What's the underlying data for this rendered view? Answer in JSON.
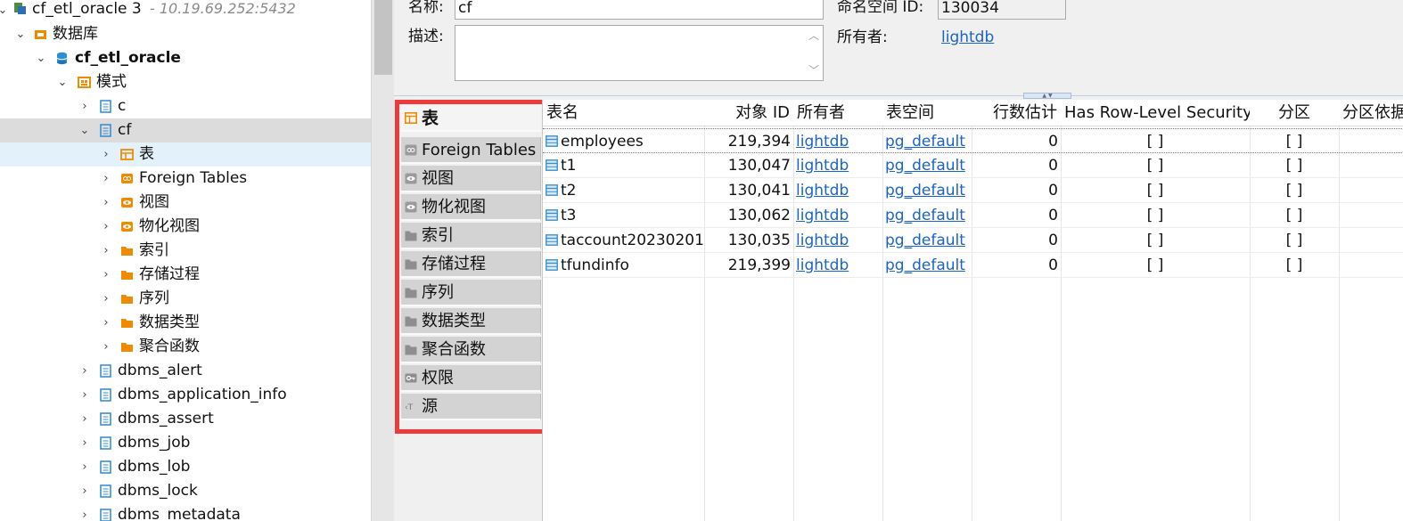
{
  "tree": {
    "connection": {
      "label": "cf_etl_oracle 3",
      "host": "- 10.19.69.252:5432"
    },
    "databases_folder": "数据库",
    "database": "cf_etl_oracle",
    "schemas_folder": "模式",
    "schema_c": "c",
    "schema_cf": "cf",
    "cf_children": [
      "表",
      "Foreign Tables",
      "视图",
      "物化视图",
      "索引",
      "存储过程",
      "序列",
      "数据类型",
      "聚合函数"
    ],
    "other_schemas": [
      "dbms_alert",
      "dbms_application_info",
      "dbms_assert",
      "dbms_job",
      "dbms_lob",
      "dbms_lock",
      "dbms_metadata"
    ]
  },
  "form": {
    "name_label": "名称:",
    "name_value": "cf",
    "namespace_label": "命名空间 ID:",
    "namespace_value": "130034",
    "desc_label": "描述:",
    "owner_label": "所有者:",
    "owner_value": "lightdb"
  },
  "tabs": [
    {
      "label": "表",
      "icon": "table-icon",
      "active": true
    },
    {
      "label": "Foreign Tables",
      "icon": "foreign-table-icon",
      "active": false
    },
    {
      "label": "视图",
      "icon": "view-icon",
      "active": false
    },
    {
      "label": "物化视图",
      "icon": "materialized-view-icon",
      "active": false
    },
    {
      "label": "索引",
      "icon": "folder-icon",
      "active": false
    },
    {
      "label": "存储过程",
      "icon": "folder-icon",
      "active": false
    },
    {
      "label": "序列",
      "icon": "folder-icon",
      "active": false
    },
    {
      "label": "数据类型",
      "icon": "folder-icon",
      "active": false
    },
    {
      "label": "聚合函数",
      "icon": "folder-icon",
      "active": false
    },
    {
      "label": "权限",
      "icon": "key-icon",
      "active": false
    },
    {
      "label": "源",
      "icon": "source-icon",
      "active": false
    }
  ],
  "table": {
    "columns": [
      "表名",
      "对象 ID",
      "所有者",
      "表空间",
      "行数估计",
      "Has Row-Level Security",
      "分区",
      "分区依据"
    ],
    "rows": [
      [
        "employees",
        "219,394",
        "lightdb",
        "pg_default",
        "0",
        "[ ]",
        "[ ]",
        ""
      ],
      [
        "t1",
        "130,047",
        "lightdb",
        "pg_default",
        "0",
        "[ ]",
        "[ ]",
        ""
      ],
      [
        "t2",
        "130,041",
        "lightdb",
        "pg_default",
        "0",
        "[ ]",
        "[ ]",
        ""
      ],
      [
        "t3",
        "130,062",
        "lightdb",
        "pg_default",
        "0",
        "[ ]",
        "[ ]",
        ""
      ],
      [
        "taccount20230201",
        "130,035",
        "lightdb",
        "pg_default",
        "0",
        "[ ]",
        "[ ]",
        ""
      ],
      [
        "tfundinfo",
        "219,399",
        "lightdb",
        "pg_default",
        "0",
        "[ ]",
        "[ ]",
        ""
      ]
    ]
  },
  "colors": {
    "accent": "#1a63c7",
    "highlight": "#ef3a3a",
    "folder": "#f08a00",
    "schema": "#3a8fd0"
  }
}
